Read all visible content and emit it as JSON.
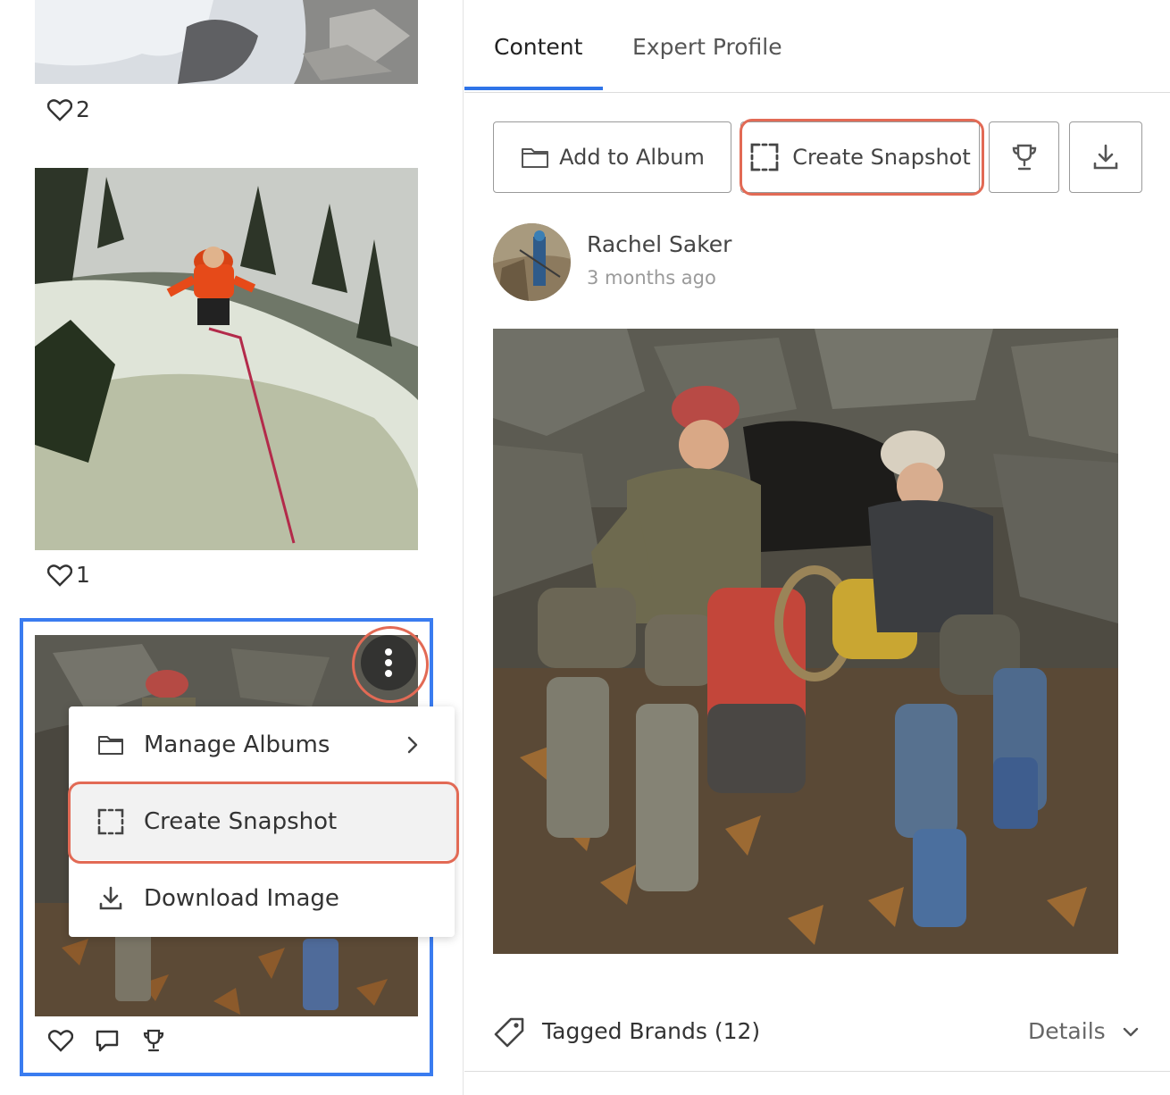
{
  "feed": {
    "posts": [
      {
        "likes": "2"
      },
      {
        "likes": "1"
      }
    ]
  },
  "context_menu": {
    "items": [
      {
        "label": "Manage Albums",
        "icon": "folder-icon"
      },
      {
        "label": "Create Snapshot",
        "icon": "snapshot-frame-icon"
      },
      {
        "label": "Download Image",
        "icon": "download-icon"
      }
    ]
  },
  "detail": {
    "tabs": [
      {
        "label": "Content",
        "active": true
      },
      {
        "label": "Expert Profile",
        "active": false
      }
    ],
    "toolbar": {
      "add_to_album": "Add to Album",
      "create_snapshot": "Create Snapshot"
    },
    "author": {
      "name": "Rachel Saker",
      "time": "3 months ago"
    },
    "tagged_brands": "Tagged Brands (12)",
    "details_label": "Details"
  },
  "colors": {
    "accent_blue": "#2f74e8",
    "selection_blue": "#3a7cf0",
    "highlight_red": "#e26a55"
  }
}
